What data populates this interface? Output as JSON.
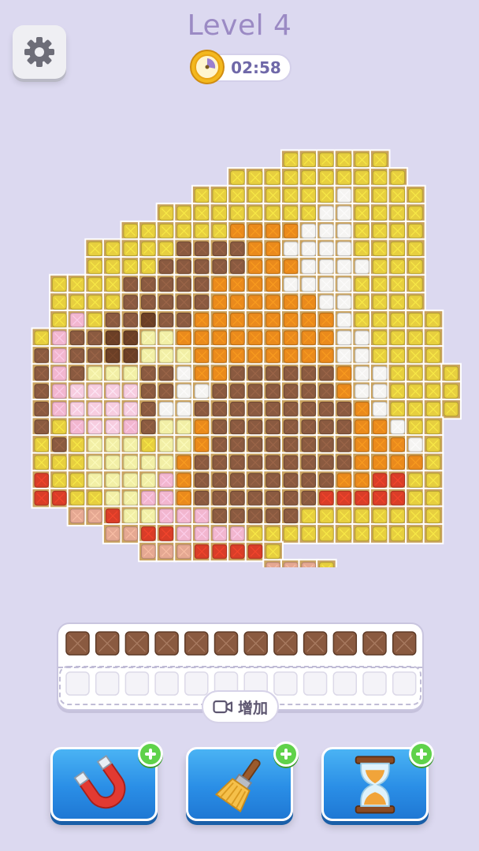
{
  "header": {
    "level_title": "Level 4",
    "timer": "02:58"
  },
  "icons": {
    "settings": "gear-icon",
    "timer": "clock-icon",
    "video": "video-camera-icon",
    "magnet": "magnet-icon",
    "brush": "brush-icon",
    "hourglass": "hourglass-icon",
    "plus": "plus-icon"
  },
  "board": {
    "palette": {
      "Y": "#e7cf3f",
      "O": "#ea8a1c",
      "B": "#8a5a40",
      "D": "#6b3f26",
      "W": "#f5f4f2",
      "C": "#f2efa6",
      "L": "#e3dc66",
      "P": "#f2b6cf",
      "K": "#f7cde0",
      "R": "#d93d28",
      "S": "#e5a892",
      "F": "#ec9326",
      "M": "#e0cfa8"
    },
    "rows": [
      "......YYYYYY.........",
      ".....YYYYYYYYYY......",
      "....YYYYYYYYWYYYY....",
      "...YYYYYYYYYWWYYYY...",
      "..YYYYYYOOOOWWWYYYY..",
      ".YYYYYBBBBOOWWWWYYYY.",
      ".YYYYBBBBBOOOWWWWYYY.",
      "YYYYBBBBBOOOOWWWWYYYY",
      "YYYYBBBBBOOOOOOWWYYYY",
      "YPYBBDBBOOOOOOOOWYYYYY",
      "YPBBDDCCOOOOOOOOOWWYYYY",
      "BPBBDDCCCOOOOOOOOWWYYYY",
      "BPBCCCBBWOOBBBBBBOWWYYYY",
      "BPKKKKBBWWBBBBBBBOWWYYYY",
      "BPKKKKBWWBBBBBBBBBOWYYYY",
      "BYPKKPBCCOBBBBBBBBOOWYY",
      "YBYCCCYCCOBBBBBBBBOOOWY",
      "YYYCCCCCOBBBBBBBBBOOOOY",
      "RYYCCCCPOBBBBBBBBOORRYY",
      "RRYYCCPPOBBBBBBBRRRRRYY",
      ".SSRCCPPPBBBBBYYYYYYYY.",
      "..SSRRPPPPYYYYYYYYYYY..",
      "...SSSRRRRY............",
      ".........SSSY.........."
    ]
  },
  "tray": {
    "filled_count": 12,
    "slot_count": 12,
    "add_label": "增加"
  }
}
